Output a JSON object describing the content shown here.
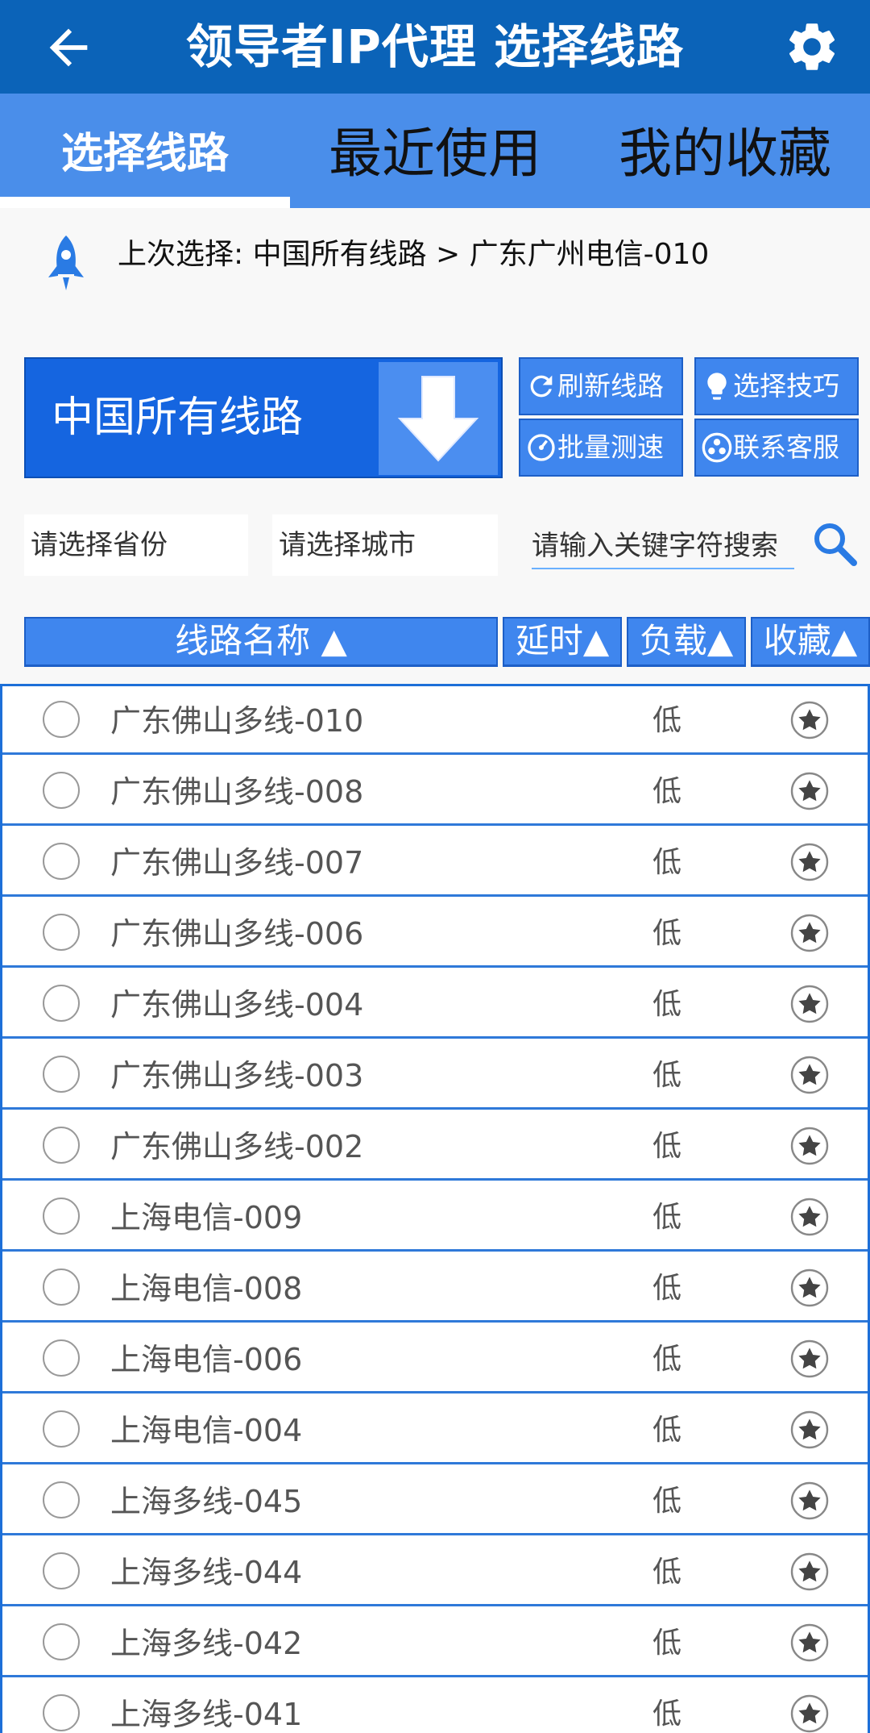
{
  "appbar": {
    "title": "领导者IP代理 选择线路",
    "back_icon": "arrow-left-icon",
    "settings_icon": "gear-icon"
  },
  "tabs": [
    {
      "label": "选择线路",
      "active": true
    },
    {
      "label": "最近使用",
      "active": false
    },
    {
      "label": "我的收藏",
      "active": false
    }
  ],
  "last_selection": {
    "icon": "rocket-icon",
    "text": "上次选择: 中国所有线路 > 广东广州电信-010"
  },
  "line_group": {
    "label": "中国所有线路",
    "icon": "arrow-down-icon"
  },
  "actions": {
    "refresh": "刷新线路",
    "tips": "选择技巧",
    "speed_test": "批量测速",
    "support": "联系客服"
  },
  "filters": {
    "province_placeholder": "请选择省份",
    "city_placeholder": "请选择城市",
    "search_placeholder": "请输入关键字符搜索"
  },
  "columns": {
    "name": "线路名称 ▲",
    "latency": "延时▲",
    "load": "负载▲",
    "favorite": "收藏▲"
  },
  "rows": [
    {
      "name": "广东佛山多线-010",
      "load": "低"
    },
    {
      "name": "广东佛山多线-008",
      "load": "低"
    },
    {
      "name": "广东佛山多线-007",
      "load": "低"
    },
    {
      "name": "广东佛山多线-006",
      "load": "低"
    },
    {
      "name": "广东佛山多线-004",
      "load": "低"
    },
    {
      "name": "广东佛山多线-003",
      "load": "低"
    },
    {
      "name": "广东佛山多线-002",
      "load": "低"
    },
    {
      "name": "上海电信-009",
      "load": "低"
    },
    {
      "name": "上海电信-008",
      "load": "低"
    },
    {
      "name": "上海电信-006",
      "load": "低"
    },
    {
      "name": "上海电信-004",
      "load": "低"
    },
    {
      "name": "上海多线-045",
      "load": "低"
    },
    {
      "name": "上海多线-044",
      "load": "低"
    },
    {
      "name": "上海多线-042",
      "load": "低"
    },
    {
      "name": "上海多线-041",
      "load": "低"
    }
  ],
  "colors": {
    "appbar": "#0b63b8",
    "tabs": "#4a8eea",
    "accent": "#1565e0",
    "row_border": "#2f79d9"
  }
}
